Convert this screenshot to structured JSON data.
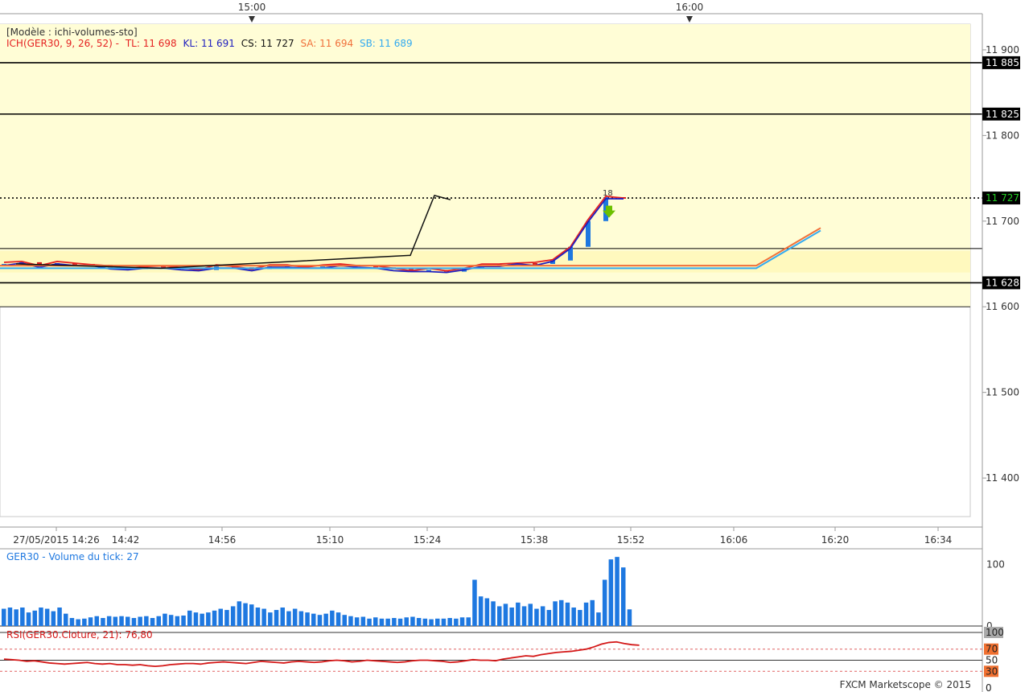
{
  "header": {
    "time_ticks": [
      {
        "label": "15:00"
      },
      {
        "label": "16:00"
      }
    ]
  },
  "colors": {
    "background": "#fffdd6",
    "cloud": "#fff9be",
    "tl": "#e52222",
    "kl": "#1f1fbf",
    "cs": "#111111",
    "sa": "#f0703a",
    "sb": "#33aaf0",
    "candle_up": "#1e78e0",
    "candle_down": "#d81e1e",
    "volume": "#1e78e0",
    "rsi": "#d41818",
    "price_badge_bg": "#000000",
    "price_badge_text": "#ffffff",
    "current_price_text": "#22cc22"
  },
  "legend": {
    "model": "[Modèle : ichi-volumes-sto]",
    "ich_label": "ICH(GER30, 9, 26, 52) -",
    "tl": "TL: 11 698",
    "kl": "KL: 11 691",
    "cs": "CS: 11 727",
    "sa": "SA: 11 694",
    "sb": "SB: 11 689"
  },
  "volume_panel": {
    "title": "GER30 - Volume du tick: 27"
  },
  "rsi_panel": {
    "title": "RSI(GER30.Cloture, 21): 76,80"
  },
  "footer": {
    "credit": "FXCM Marketscope © 2015"
  },
  "chart_data": [
    {
      "type": "candlestick",
      "title": "GER30",
      "x_labels": [
        "27/05/2015 14:26",
        "14:42",
        "14:56",
        "15:10",
        "15:24",
        "15:38",
        "15:52",
        "16:06",
        "16:20",
        "16:34"
      ],
      "y_ticks": [
        "11 400",
        "11 500",
        "11 600",
        "11 700",
        "11 800",
        "11 900"
      ],
      "ylim": [
        11355,
        11930
      ],
      "horizontal_levels": [
        {
          "label": "11 885",
          "value": 11885,
          "style": "solid"
        },
        {
          "label": "11 825",
          "value": 11825,
          "style": "solid"
        },
        {
          "label": "11 727",
          "value": 11727,
          "style": "dotted",
          "current": true
        },
        {
          "label": "11 628",
          "value": 11628,
          "style": "solid"
        }
      ],
      "zones": [
        {
          "from": 11600,
          "to": 11930,
          "name": "yellow zone"
        }
      ],
      "annotation": {
        "text": "18",
        "marker": "down-arrow"
      },
      "close_series_approx": [
        11650,
        11652,
        11648,
        11651,
        11650,
        11649,
        11646,
        11644,
        11647,
        11646,
        11645,
        11643,
        11647,
        11646,
        11644,
        11647,
        11648,
        11646,
        11647,
        11649,
        11648,
        11646,
        11644,
        11642,
        11643,
        11641,
        11645,
        11648,
        11649,
        11651,
        11650,
        11654,
        11670,
        11700,
        11728,
        11727
      ],
      "ichimoku": {
        "TL": 11698,
        "KL": 11691,
        "CS": 11727,
        "SA": 11694,
        "SB": 11689
      }
    },
    {
      "type": "bar",
      "title": "GER30 - Volume du tick: 27",
      "y_ticks": [
        "0",
        "100"
      ],
      "ylim": [
        0,
        120
      ],
      "values": [
        28,
        30,
        27,
        30,
        22,
        25,
        30,
        28,
        24,
        30,
        20,
        13,
        11,
        12,
        14,
        16,
        13,
        16,
        15,
        16,
        15,
        13,
        15,
        16,
        13,
        16,
        20,
        18,
        16,
        17,
        25,
        22,
        20,
        22,
        25,
        28,
        26,
        32,
        40,
        37,
        35,
        30,
        28,
        22,
        26,
        30,
        24,
        28,
        24,
        22,
        20,
        18,
        20,
        25,
        22,
        18,
        16,
        14,
        15,
        12,
        14,
        12,
        12,
        13,
        12,
        14,
        15,
        13,
        12,
        11,
        12,
        12,
        13,
        12,
        14,
        14,
        75,
        48,
        45,
        40,
        32,
        36,
        30,
        38,
        32,
        36,
        28,
        32,
        26,
        40,
        42,
        38,
        30,
        26,
        38,
        42,
        22,
        75,
        108,
        112,
        95,
        27
      ]
    },
    {
      "type": "line",
      "title": "RSI(GER30.Cloture, 21): 76,80",
      "y_ticks": [
        "0",
        "30",
        "50",
        "70",
        "100"
      ],
      "ylim": [
        0,
        100
      ],
      "reference_levels": [
        30,
        50,
        70
      ],
      "values": [
        52,
        51,
        50,
        48,
        49,
        47,
        45,
        44,
        43,
        44,
        45,
        46,
        44,
        43,
        44,
        42,
        42,
        41,
        42,
        40,
        39,
        40,
        42,
        43,
        44,
        44,
        43,
        45,
        46,
        47,
        46,
        45,
        44,
        46,
        48,
        47,
        46,
        45,
        47,
        48,
        47,
        46,
        47,
        49,
        50,
        49,
        47,
        48,
        50,
        49,
        48,
        47,
        46,
        47,
        49,
        50,
        50,
        49,
        48,
        46,
        47,
        49,
        51,
        50,
        50,
        49,
        52,
        54,
        56,
        58,
        57,
        60,
        62,
        64,
        65,
        66,
        68,
        70,
        74,
        79,
        82,
        83,
        80,
        78,
        77
      ]
    }
  ]
}
